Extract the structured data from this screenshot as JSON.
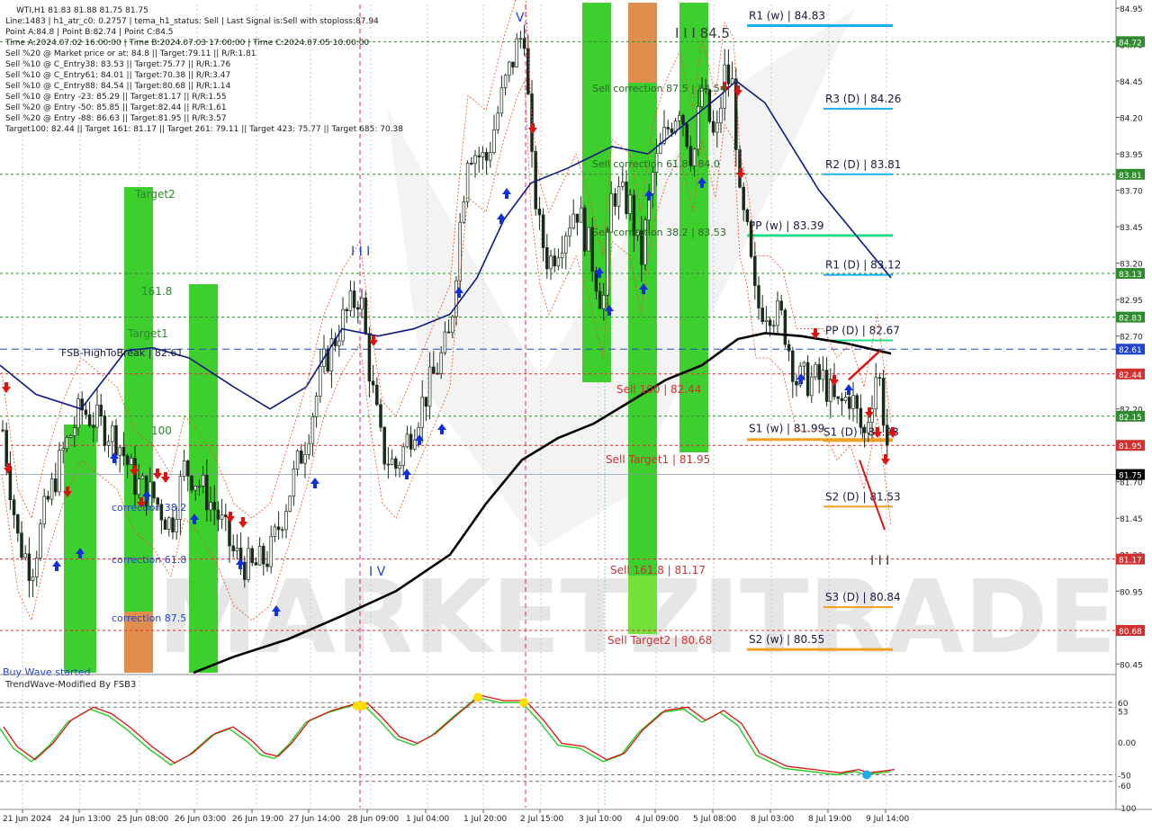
{
  "header": {
    "symbol_line": "WTI,H1  81.83 81.88 81.75 81.75",
    "lines": [
      "Line:1483  |  h1_atr_c0: 0.2757  |  tema_h1_status: Sell  |  Last Signal is:Sell with stoploss:87.94",
      "Point A:84.8  |  Point B:82.74  |  Point C:84.5",
      "Time A:2024.07.02 16:00:00  |  Time B:2024.07.03 17:00:00  |  Time C:2024.07.05 10:00:00",
      "Sell %20 @ Market price or at: 84.8  ||  Target:79.11  ||  R/R:1.81",
      "Sell %10 @ C_Entry38: 83.53  ||  Target:75.77  ||  R/R:1.76",
      "Sell %10 @ C_Entry61: 84.01  ||  Target:70.38  ||  R/R:3.47",
      "Sell %10 @ C_Entry88: 84.54  ||  Target:80.68  ||  R/R:1.14",
      "Sell %10 @ Entry -23: 85.29  ||  Target:81.17  ||  R/R:1.55",
      "Sell %20 @ Entry -50: 85.85  ||  Target:82.44  ||  R/R:1.61",
      "Sell %20 @ Entry -88: 86.63  ||  Target:81.95  ||  R/R:3.57",
      "Target100: 82.44  ||  Target 161: 81.17  ||  Target 261: 79.11  ||  Target 423: 75.77  ||  Target 685: 70.38"
    ]
  },
  "watermark": "MARKETZITRADE",
  "price_axis": [
    "84.95",
    "84.70",
    "84.45",
    "84.20",
    "83.95",
    "83.70",
    "83.45",
    "83.20",
    "82.95",
    "82.70",
    "82.45",
    "82.20",
    "81.95",
    "81.70",
    "81.45",
    "81.20",
    "80.95",
    "80.70",
    "80.45"
  ],
  "price_tags": [
    {
      "label": "84.72",
      "price": 84.72,
      "color": "#2e8b2e"
    },
    {
      "label": "83.81",
      "price": 83.81,
      "color": "#2e8b2e"
    },
    {
      "label": "83.13",
      "price": 83.13,
      "color": "#2e8b2e"
    },
    {
      "label": "82.83",
      "price": 82.83,
      "color": "#2e8b2e"
    },
    {
      "label": "82.61",
      "price": 82.61,
      "color": "#2244cc"
    },
    {
      "label": "82.44",
      "price": 82.44,
      "color": "#d03030"
    },
    {
      "label": "82.15",
      "price": 82.15,
      "color": "#2e8b2e"
    },
    {
      "label": "81.95",
      "price": 81.95,
      "color": "#d03030"
    },
    {
      "label": "81.75",
      "price": 81.75,
      "color": "#000000"
    },
    {
      "label": "81.17",
      "price": 81.17,
      "color": "#d03030"
    },
    {
      "label": "80.68",
      "price": 80.68,
      "color": "#d03030"
    }
  ],
  "date_axis": [
    "21 Jun 2024",
    "24 Jun 13:00",
    "25 Jun 08:00",
    "26 Jun 03:00",
    "26 Jun 19:00",
    "27 Jun 14:00",
    "28 Jun 09:00",
    "1 Jul 04:00",
    "1 Jul 20:00",
    "2 Jul 15:00",
    "3 Jul 10:00",
    "4 Jul 09:00",
    "5 Jul 08:00",
    "8 Jul 03:00",
    "8 Jul 19:00",
    "9 Jul 14:00"
  ],
  "pivot_labels": [
    {
      "text": "R1 (w) | 84.83",
      "price": 84.83,
      "color": "#1ab0f0"
    },
    {
      "text": "R3 (D) | 84.26",
      "price": 84.26,
      "color": "#1ab0f0"
    },
    {
      "text": "R2 (D) | 83.81",
      "price": 83.81,
      "color": "#1ab0f0"
    },
    {
      "text": "PP (w) | 83.39",
      "price": 83.39,
      "color": "#22dd88"
    },
    {
      "text": "R1 (D) | 83.12",
      "price": 83.12,
      "color": "#1ab0f0"
    },
    {
      "text": "PP (D) | 82.67",
      "price": 82.67,
      "color": "#22dd88"
    },
    {
      "text": "S1 (w) | 81.99",
      "price": 81.99,
      "color": "#f0a020"
    },
    {
      "text": "S1 (D) | 81.98",
      "price": 81.98,
      "color": "#f0a020"
    },
    {
      "text": "S2 (D) | 81.53",
      "price": 81.53,
      "color": "#f0a020"
    },
    {
      "text": "S3 (D) | 80.84",
      "price": 80.84,
      "color": "#f0a020"
    },
    {
      "text": "S2 (w) | 80.55",
      "price": 80.55,
      "color": "#f0a020"
    }
  ],
  "chart_labels": {
    "target2": "Target2",
    "level_161_8": "161.8",
    "target1": "Target1",
    "level_100": "100",
    "fsb": "FSB-HighToBreak | 82.61",
    "correction_38_2": "correction 38.2",
    "correction_61_8": "correction 61.8",
    "correction_87_5": "correction 87.5",
    "buy_wave": "Buy Wave started",
    "sell_corr_87_5": "Sell correction 87.5 | 84.54",
    "sell_corr_61_8": "Sell correction 61.8 | 84.0",
    "sell_corr_38_2": "Sell correction 38.2 | 83.53",
    "sell_100": "Sell 100 | 82.44",
    "sell_target1": "Sell Target1 | 81.95",
    "sell_161_8": "Sell 161.8 | 81.17",
    "sell_target2": "Sell Target2 | 80.68",
    "wave_iii_845": "I I I 84.5",
    "wave_v": "V",
    "wave_iii": "I I I",
    "wave_iv": "I V",
    "wave_iii_right": "I I I"
  },
  "oscillator": {
    "title": "TrendWave-Modified By FSB3",
    "axis": [
      "60",
      "53",
      "0.00",
      "-50",
      "-60",
      "-100"
    ]
  },
  "colors": {
    "up_arrow": "#1030e0",
    "down_arrow": "#e01010",
    "ema": "#0a1a80",
    "sma": "#000000",
    "zone_green": "#33cc22",
    "zone_orange": "#dd8844"
  }
}
